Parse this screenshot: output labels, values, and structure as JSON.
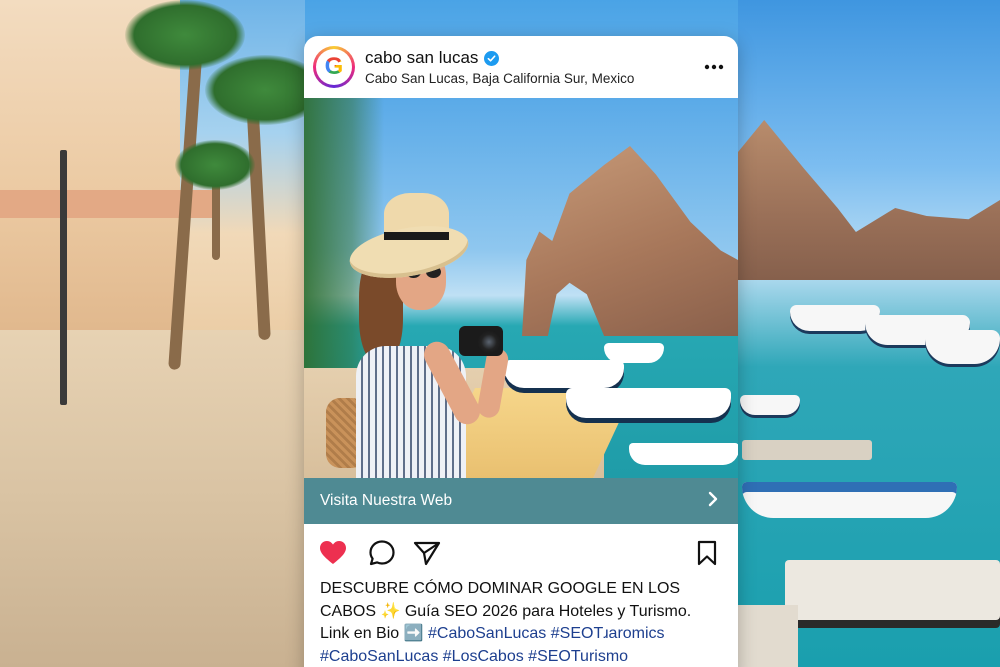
{
  "post": {
    "account_name": "cabo san lucas",
    "location": "Cabo San Lucas, Baja California Sur, Mexico",
    "avatar_letter": "G",
    "more_icon": "more-horizontal-icon",
    "cta_label": "Visita Nuestra Web",
    "cta_icon": "chevron-right-icon",
    "actions": {
      "like_icon": "heart-icon",
      "comment_icon": "comment-icon",
      "share_icon": "send-icon",
      "save_icon": "bookmark-icon",
      "like_color": "#ed3050"
    },
    "caption": {
      "line1": "DESCUBRE CÓMO DOMINAR GOOGLE EN LOS",
      "line2": "CABOS ✨ Guía SEO 2026 para Hoteles y Turismo.",
      "line3_prefix": "Link en Bio ➡️",
      "line3_tag1": "#CaboSanLucas",
      "line3_tag2": "#SEOTɹaromics",
      "line4_tag1": "#CaboSanLucas",
      "line4_tag2": "#LosCabos",
      "line4_tag3": "#SEOTurismo"
    }
  },
  "colors": {
    "cta_background": "#4f8a93",
    "hashtag": "#1d3f8f",
    "verified_badge": "#1d9bf0"
  }
}
